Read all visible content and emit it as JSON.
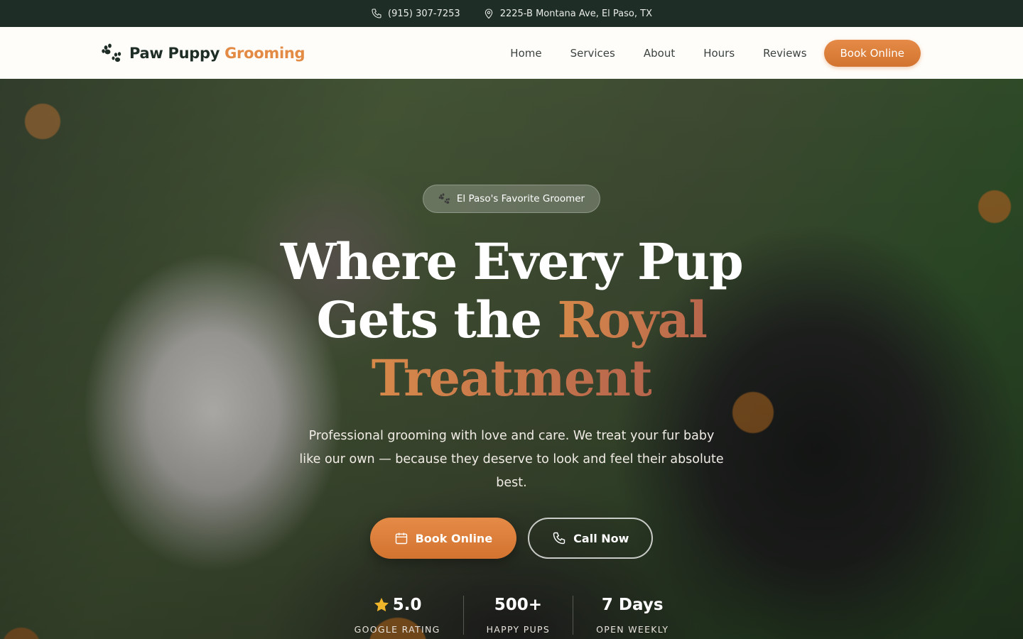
{
  "topbar": {
    "phone": "(915) 307-7253",
    "address": "2225-B Montana Ave, El Paso, TX"
  },
  "nav": {
    "brand_main": "Paw Puppy",
    "brand_accent": "Grooming",
    "links": [
      "Home",
      "Services",
      "About",
      "Hours",
      "Reviews"
    ],
    "cta": "Book Online"
  },
  "hero": {
    "badge": "El Paso's Favorite Groomer",
    "headline_line1": "Where Every Pup",
    "headline_line2_plain": "Gets the",
    "headline_line2_accent": "Royal",
    "headline_line3_accent": "Treatment",
    "subtext": "Professional grooming with love and care. We treat your fur baby like our own — because they deserve to look and feel their absolute best.",
    "cta_primary": "Book Online",
    "cta_secondary": "Call Now",
    "stats": [
      {
        "value": "5.0",
        "label": "GOOGLE RATING",
        "icon": "star-icon"
      },
      {
        "value": "500+",
        "label": "HAPPY PUPS"
      },
      {
        "value": "7 Days",
        "label": "OPEN WEEKLY"
      }
    ]
  },
  "colors": {
    "accent": "#e38a45",
    "dark_green": "#1f2d27",
    "star": "#f0b62b"
  }
}
